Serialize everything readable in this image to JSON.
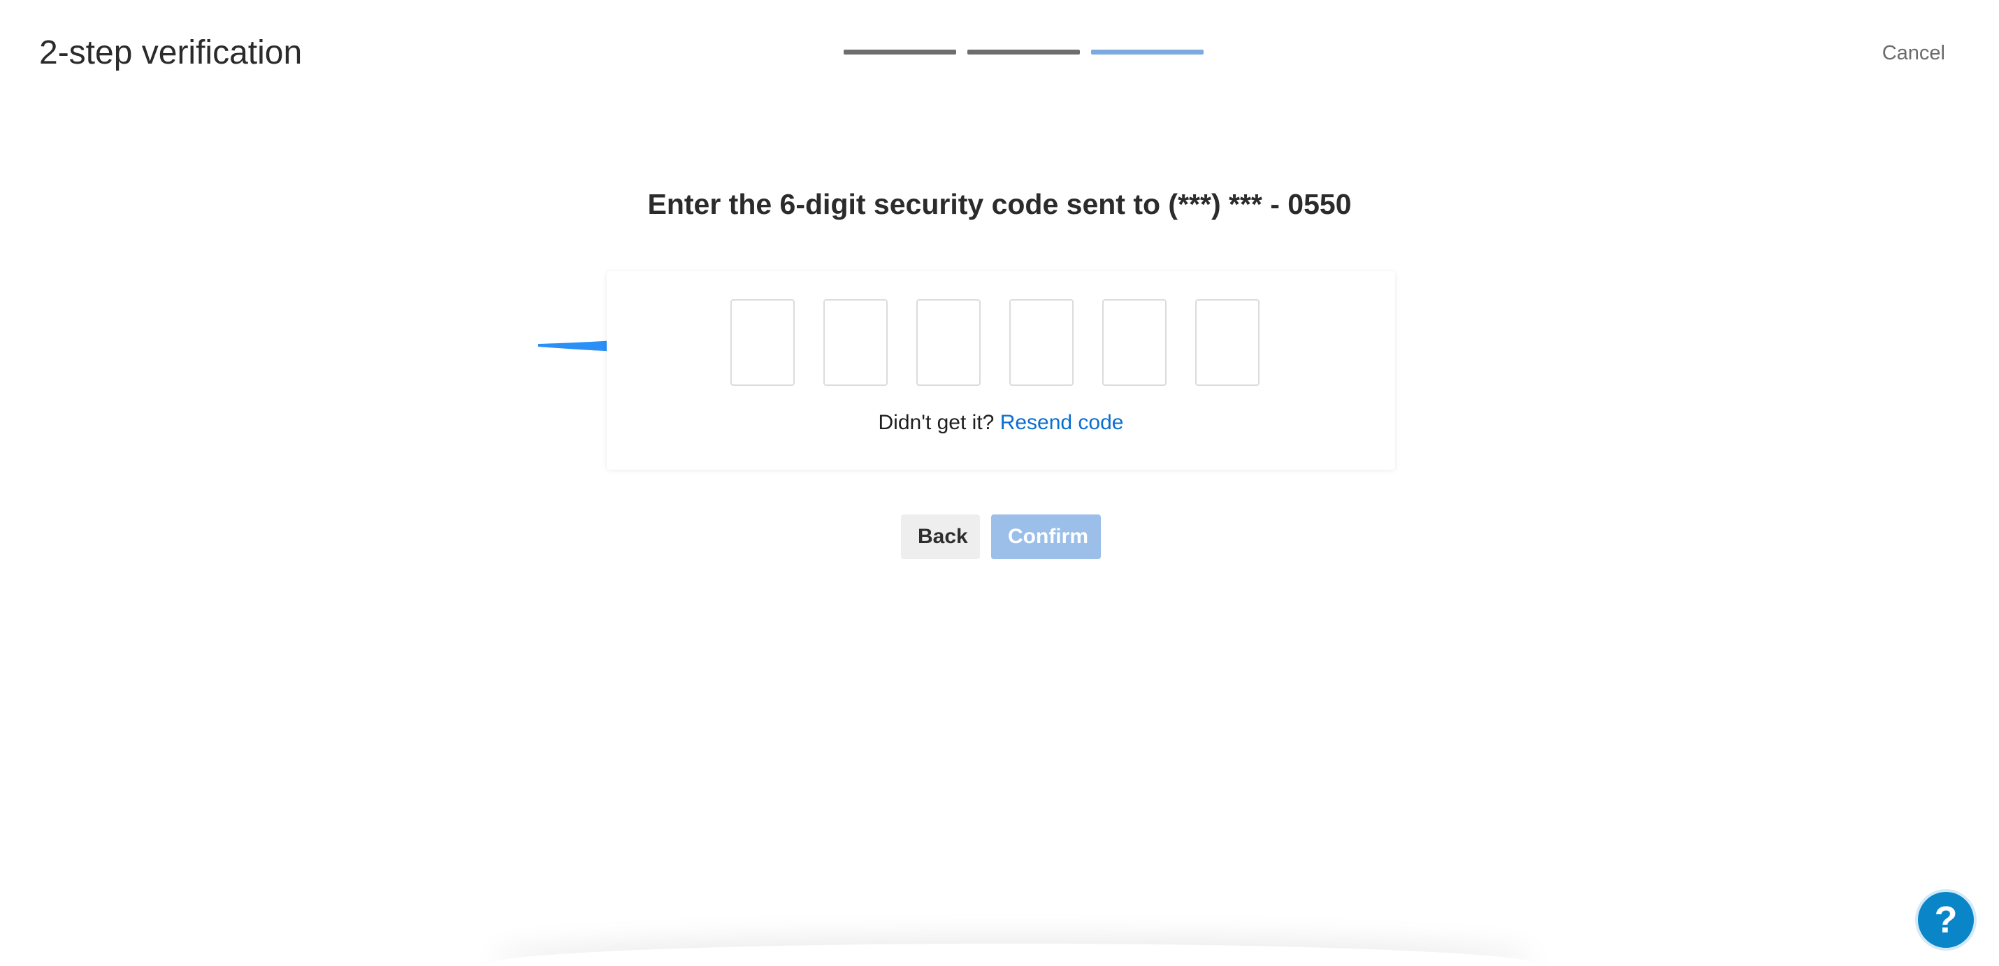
{
  "header": {
    "title": "2-step verification",
    "cancel_label": "Cancel",
    "progress": {
      "total_steps": 3,
      "current_step": 3
    }
  },
  "main": {
    "heading": "Enter the 6-digit security code sent to (***) *** - 0550",
    "code_digits": [
      "",
      "",
      "",
      "",
      "",
      ""
    ],
    "resend_prompt": "Didn't get it?",
    "resend_link": "Resend code"
  },
  "actions": {
    "back_label": "Back",
    "confirm_label": "Confirm",
    "confirm_enabled": false
  },
  "help": {
    "icon": "question-mark-icon",
    "label": "?"
  },
  "colors": {
    "progress_done": "#6d6d6d",
    "progress_current": "#7ca9de",
    "link": "#0a6ed1",
    "confirm_disabled": "#9bbfe9",
    "arrow": "#2a8ff7",
    "help_button": "#0a86c8"
  }
}
